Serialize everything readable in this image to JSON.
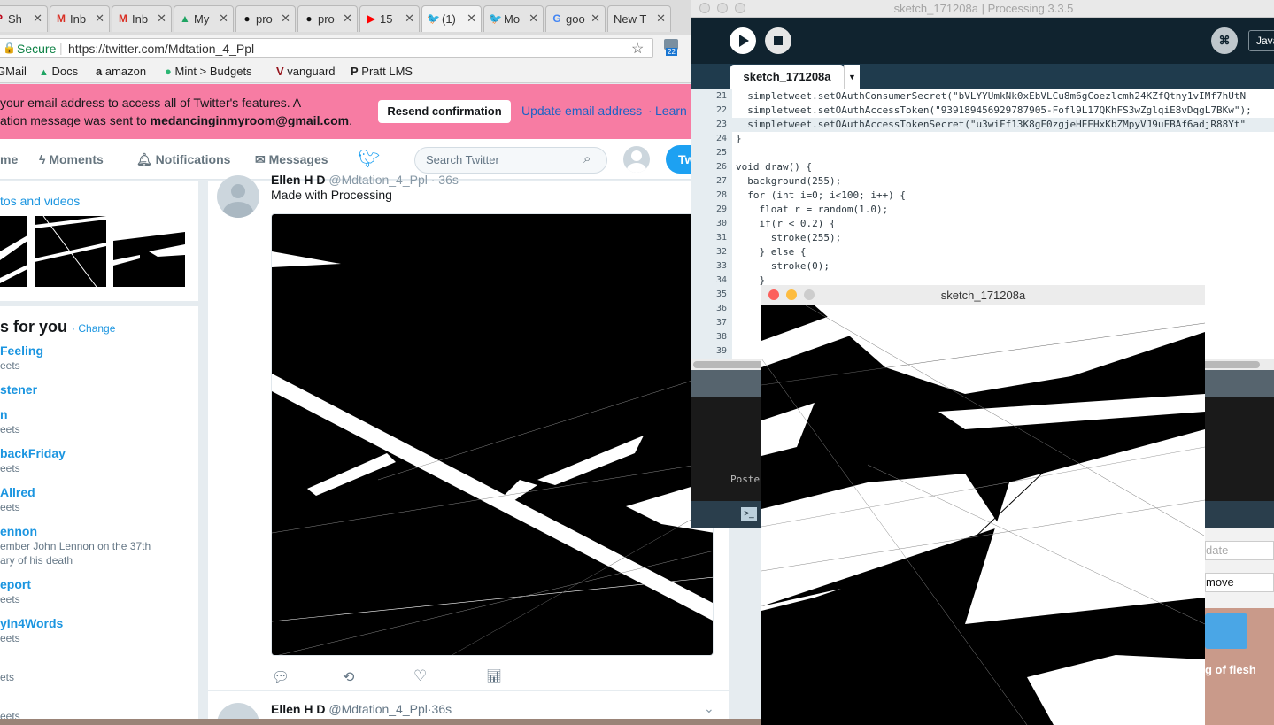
{
  "browser": {
    "tabs": [
      {
        "icon": "pinterest-icon",
        "label": "Sh"
      },
      {
        "icon": "gmail-icon",
        "label": "Inb"
      },
      {
        "icon": "gmail-icon",
        "label": "Inb"
      },
      {
        "icon": "drive-icon",
        "label": "My"
      },
      {
        "icon": "github-icon",
        "label": "pro"
      },
      {
        "icon": "github-icon",
        "label": "pro"
      },
      {
        "icon": "youtube-icon",
        "label": "15"
      },
      {
        "icon": "twitter-icon",
        "label": "(1)"
      },
      {
        "icon": "twitter-icon",
        "label": "Mo"
      },
      {
        "icon": "google-icon",
        "label": "goo"
      },
      {
        "icon": "",
        "label": "New T"
      }
    ],
    "address": {
      "secure_label": "Secure",
      "url": "https://twitter.com/Mdtation_4_Ppl"
    },
    "extension_badge": "22",
    "bookmarks": [
      {
        "icon": "gmail-icon",
        "label": "GMail"
      },
      {
        "icon": "drive-icon",
        "label": "Docs"
      },
      {
        "icon": "amazon-icon",
        "label": "amazon"
      },
      {
        "icon": "mint-icon",
        "label": "Mint > Budgets"
      },
      {
        "icon": "vanguard-icon",
        "label": "vanguard"
      },
      {
        "icon": "pratt-icon",
        "label": "Pratt LMS"
      }
    ]
  },
  "banner": {
    "line1": "your email address to access all of Twitter's features. A",
    "line2_prefix": "ation message was sent to ",
    "email": "medancinginmyroom@gmail.com",
    "line2_suffix": ".",
    "resend_label": "Resend confirmation",
    "update_label": "Update email address",
    "separator": "·",
    "learn_label": "Learn m"
  },
  "twitter_nav": {
    "home_label": "me",
    "moments_label": "Moments",
    "notifications_label": "Notifications",
    "messages_label": "Messages",
    "search_placeholder": "Search Twitter",
    "tweet_button_label": "Tw"
  },
  "media_panel": {
    "title": "tos and videos"
  },
  "trends": {
    "title": "s for you",
    "change_label": "· Change",
    "items": [
      {
        "name": "Feeling",
        "sub": "eets"
      },
      {
        "name": "stener",
        "sub": ""
      },
      {
        "name": "n",
        "sub": "eets"
      },
      {
        "name": "backFriday",
        "sub": "eets"
      },
      {
        "name": "Allred",
        "sub": "eets"
      },
      {
        "name": "ennon",
        "sub": "ember John Lennon on the 37th"
      },
      {
        "name": "",
        "sub": "ary of his death"
      },
      {
        "name": "eport",
        "sub": "eets"
      },
      {
        "name": "yIn4Words",
        "sub": "eets"
      },
      {
        "name": "",
        "sub": "ets"
      },
      {
        "name": "",
        "sub": "eets"
      }
    ]
  },
  "tweet1": {
    "author": "Ellen H D",
    "handle": "@Mdtation_4_Ppl · 36s",
    "text": "Made with Processing"
  },
  "tweet2": {
    "author": "Ellen H D",
    "handle": "@Mdtation_4_Ppl",
    "time": "·36s"
  },
  "ide": {
    "title": "sketch_171208a | Processing 3.3.5",
    "tab_label": "sketch_171208a",
    "mode_label": "Java",
    "console_text": "Poste",
    "code_lines": [
      {
        "n": "21",
        "text": "  simpletweet.setOAuthConsumerSecret(\"bVLYYUmkNk0xEbVLCu8m6gCoezlcmh24KZfQtny1vIMf7hUtN"
      },
      {
        "n": "22",
        "text": "  simpletweet.setOAuthAccessToken(\"939189456929787905-Fofl9L17QKhFS3wZglqiE8vDqgL7BKw\");"
      },
      {
        "n": "23",
        "text": "  simpletweet.setOAuthAccessTokenSecret(\"u3wiFf13K8gF0zgjeHEEHxKbZMpyVJ9uFBAf6adjR88Yt\""
      },
      {
        "n": "24",
        "text": "}"
      },
      {
        "n": "25",
        "text": ""
      },
      {
        "n": "26",
        "text": "void draw() {"
      },
      {
        "n": "27",
        "text": "  background(255);"
      },
      {
        "n": "28",
        "text": "  for (int i=0; i<100; i++) {"
      },
      {
        "n": "29",
        "text": "    float r = random(1.0);"
      },
      {
        "n": "30",
        "text": "    if(r < 0.2) {"
      },
      {
        "n": "31",
        "text": "      stroke(255);"
      },
      {
        "n": "32",
        "text": "    } else {"
      },
      {
        "n": "33",
        "text": "      stroke(0);"
      },
      {
        "n": "34",
        "text": "    }"
      },
      {
        "n": "35",
        "text": ""
      },
      {
        "n": "36",
        "text": ""
      },
      {
        "n": "37",
        "text": ""
      },
      {
        "n": "38",
        "text": ""
      },
      {
        "n": "39",
        "text": ""
      }
    ]
  },
  "sketch_window": {
    "title": "sketch_171208a"
  },
  "background_window": {
    "date_label": "date",
    "remove_label": "move",
    "caption": "g of flesh"
  },
  "colors": {
    "twitter_blue": "#1da1f2",
    "banner_pink": "#f77ca3",
    "ide_dark": "#10232f"
  }
}
